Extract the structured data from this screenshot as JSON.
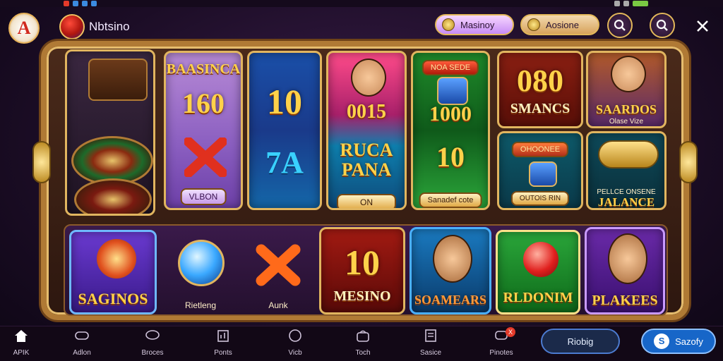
{
  "header": {
    "logo_letter": "A",
    "app_name": "Nbtsino",
    "pill_primary": "Masinoy",
    "pill_secondary": "Aosione"
  },
  "tiles": {
    "t1": {
      "top": "BAASINCA",
      "num": "160"
    },
    "t1_label": "VLBON",
    "t2": {
      "num": "10",
      "num2": "7A"
    },
    "t3": {
      "num": "0015",
      "mid": "RUCA PANA",
      "label": "ON"
    },
    "t4": {
      "top": "NOA SEDE",
      "num": "1000",
      "mid": "10",
      "label": "Sanadef cote"
    },
    "t5": {
      "num": "080",
      "sub": "SMANCS"
    },
    "t6": {
      "title": "SAARDOS",
      "sub": "Olase Vize"
    },
    "t7": {
      "top": "OHOONEE",
      "label": "OUTOIS RIN"
    },
    "t8": {
      "small": "PELLCE ONSENE",
      "title": "JALANCE"
    },
    "b1": {
      "title": "SAGINOS"
    },
    "b2": {
      "caption": "Rietleng"
    },
    "b3": {
      "caption": "Aunk"
    },
    "b4": {
      "num": "10",
      "title": "MESINO"
    },
    "b5": {
      "title": "SOAMEARS"
    },
    "b6": {
      "title": "RLDONIM"
    },
    "b7": {
      "title": "PLAKEES"
    }
  },
  "bottom_nav": {
    "items": [
      {
        "label": "APIK",
        "icon": "home-icon"
      },
      {
        "label": "Adlon",
        "icon": "controller-icon"
      },
      {
        "label": "Broces",
        "icon": "chat-icon"
      },
      {
        "label": "Ponts",
        "icon": "chart-icon"
      },
      {
        "label": "Vicb",
        "icon": "heart-icon"
      },
      {
        "label": "Toch",
        "icon": "bag-icon"
      },
      {
        "label": "Sasice",
        "icon": "list-icon"
      },
      {
        "label": "Pinotes",
        "icon": "message-icon",
        "badge": "X"
      }
    ],
    "button_a": "Riobig",
    "button_b": "Sazofy"
  },
  "colors": {
    "accent_gold": "#e1b55f",
    "primary_blue": "#1766c8",
    "background": "#1c0d26"
  }
}
